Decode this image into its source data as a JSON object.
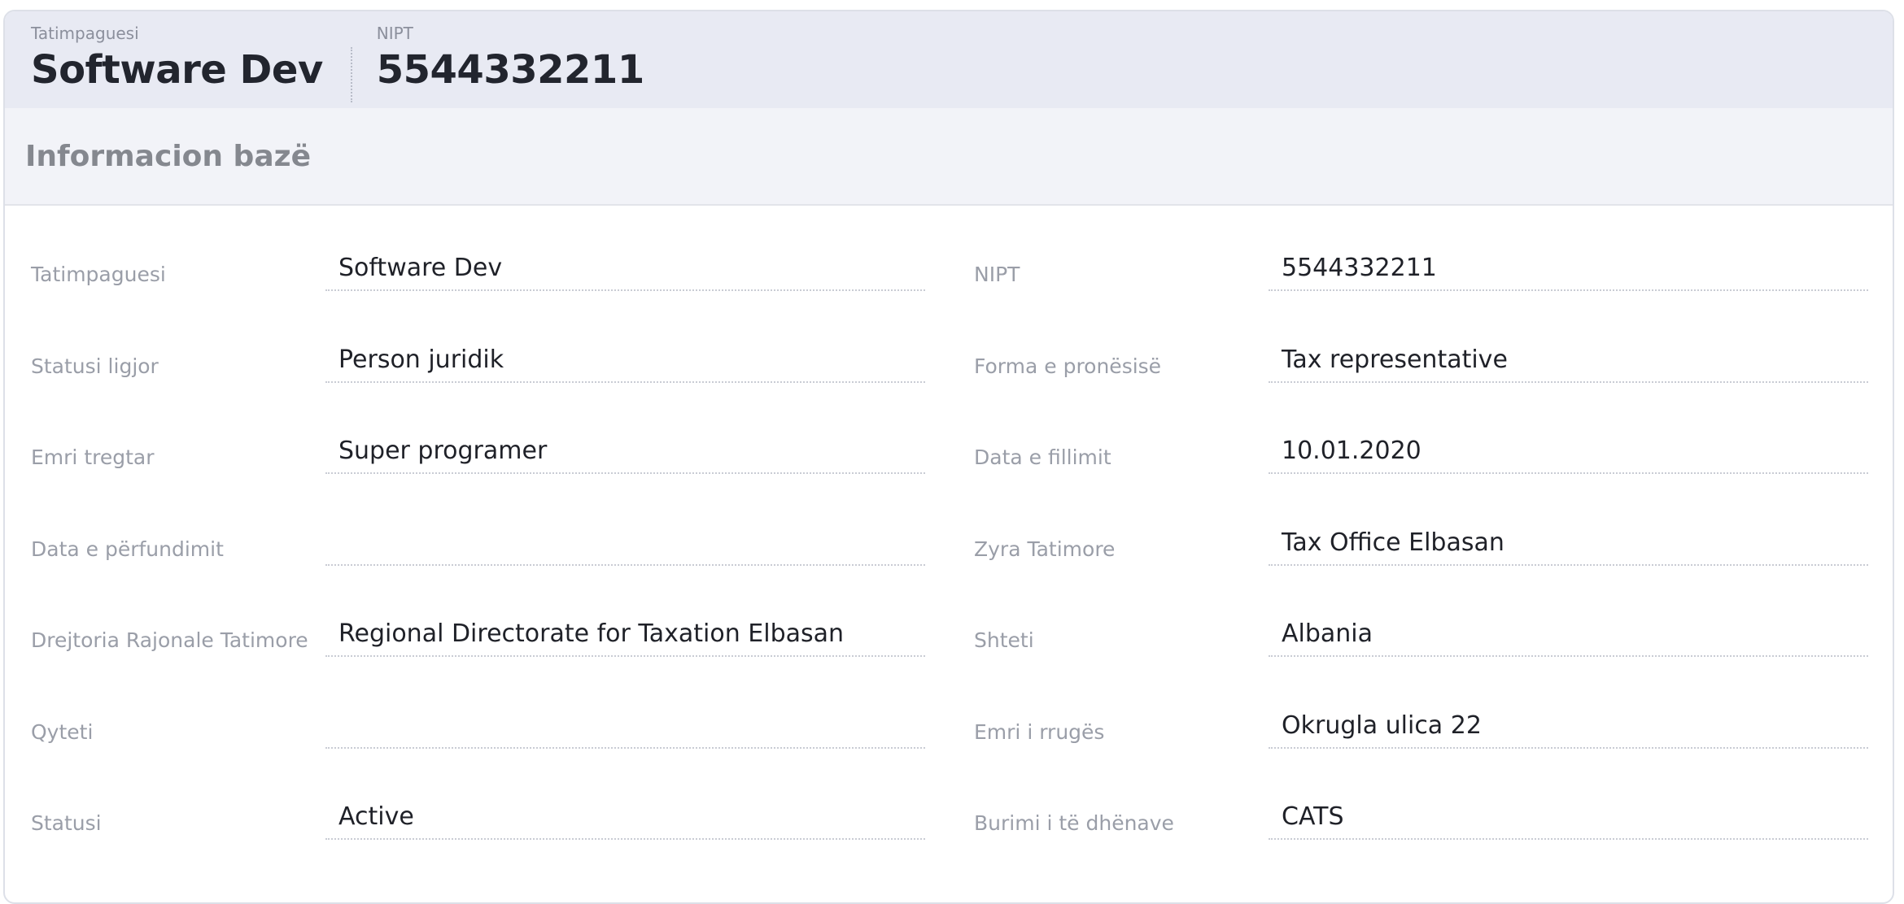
{
  "header": {
    "taxpayer_label": "Tatimpaguesi",
    "taxpayer_value": "Software Dev",
    "nipt_label": "NIPT",
    "nipt_value": "5544332211"
  },
  "section": {
    "title": "Informacion bazë"
  },
  "fields": {
    "left": [
      {
        "label": "Tatimpaguesi",
        "value": "Software Dev"
      },
      {
        "label": "Statusi ligjor",
        "value": "Person juridik"
      },
      {
        "label": "Emri tregtar",
        "value": "Super programer"
      },
      {
        "label": "Data e përfundimit",
        "value": ""
      },
      {
        "label": "Drejtoria Rajonale Tatimore",
        "value": "Regional Directorate for Taxation Elbasan"
      },
      {
        "label": "Qyteti",
        "value": ""
      },
      {
        "label": "Statusi",
        "value": "Active"
      }
    ],
    "right": [
      {
        "label": "NIPT",
        "value": "5544332211"
      },
      {
        "label": "Forma e pronësisë",
        "value": "Tax representative"
      },
      {
        "label": "Data e fillimit",
        "value": "10.01.2020"
      },
      {
        "label": "Zyra Tatimore",
        "value": "Tax Office Elbasan"
      },
      {
        "label": "Shteti",
        "value": "Albania"
      },
      {
        "label": "Emri i rrugës",
        "value": "Okrugla ulica 22"
      },
      {
        "label": "Burimi i të dhënave",
        "value": "CATS"
      }
    ]
  }
}
